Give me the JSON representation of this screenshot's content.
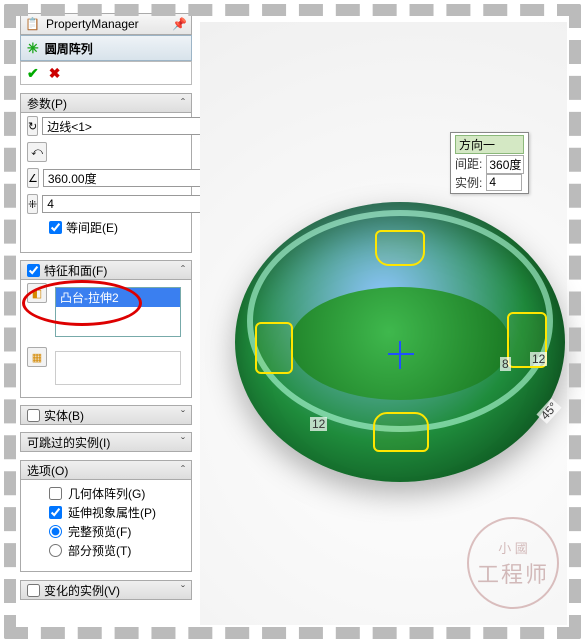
{
  "header": {
    "title": "PropertyManager"
  },
  "panel": {
    "title": "圆周阵列"
  },
  "sections": {
    "params": {
      "title": "参数(P)",
      "edge_field": "边线<1>",
      "angle": "360.00度",
      "count": "4",
      "equal_spacing_label": "等间距(E)"
    },
    "features": {
      "title": "特征和面(F)",
      "item1": "凸台-拉伸2"
    },
    "bodies": {
      "title": "实体(B)"
    },
    "skip": {
      "title": "可跳过的实例(I)"
    },
    "options": {
      "title": "选项(O)",
      "geom_pattern": "几何体阵列(G)",
      "propagate": "延伸视象属性(P)",
      "full_preview": "完整预览(F)",
      "partial_preview": "部分预览(T)"
    },
    "varied": {
      "title": "变化的实例(V)"
    }
  },
  "callout": {
    "title": "方向一",
    "spacing_label": "间距:",
    "spacing_value": "360度",
    "instances_label": "实例:",
    "instances_value": "4"
  },
  "dims": {
    "d12a": "12",
    "d12b": "12",
    "a45": "45°",
    "d8": "8"
  },
  "watermark": {
    "line1": "小 國",
    "line2": "工程师"
  }
}
